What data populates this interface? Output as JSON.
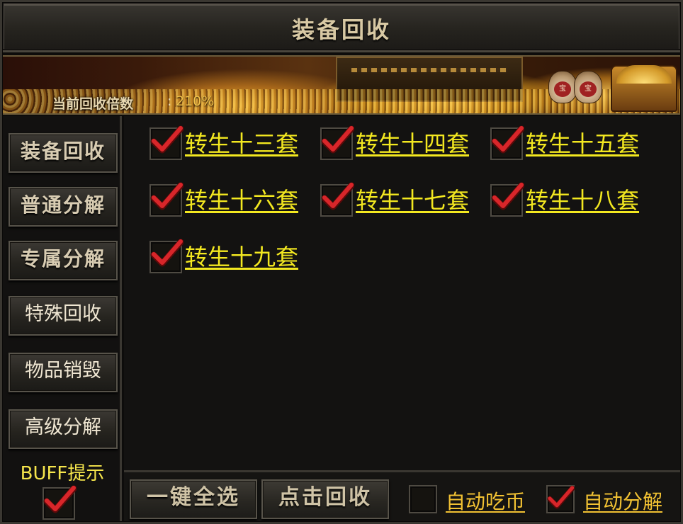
{
  "window": {
    "title": "装备回收"
  },
  "banner": {
    "rate_label": "当前回收倍数",
    "rate_sep": ":",
    "rate_value": "210%",
    "bag_text": "宝"
  },
  "sidebar": {
    "items": [
      {
        "label": "装备回收"
      },
      {
        "label": "普通分解"
      },
      {
        "label": "专属分解"
      },
      {
        "label": "特殊回收"
      },
      {
        "label": "物品销毁"
      },
      {
        "label": "高级分解"
      }
    ],
    "buff_label": "BUFF提示",
    "buff_checked": true
  },
  "recycle_sets": [
    {
      "label": "转生十三套",
      "checked": true
    },
    {
      "label": "转生十四套",
      "checked": true
    },
    {
      "label": "转生十五套",
      "checked": true
    },
    {
      "label": "转生十六套",
      "checked": true
    },
    {
      "label": "转生十七套",
      "checked": true
    },
    {
      "label": "转生十八套",
      "checked": true
    },
    {
      "label": "转生十九套",
      "checked": true
    }
  ],
  "bottom": {
    "select_all_label": "一键全选",
    "recycle_label": "点击回收",
    "auto_coin_label": "自动吃币",
    "auto_coin_checked": false,
    "auto_decompose_label": "自动分解",
    "auto_decompose_checked": true
  },
  "colors": {
    "item_text": "#f3e820",
    "option_text": "#f2c233",
    "buff_text": "#f6e64c",
    "check_red": "#d8262a",
    "rate_value": "#f2c14a"
  },
  "icons": {
    "check": "check-icon"
  }
}
